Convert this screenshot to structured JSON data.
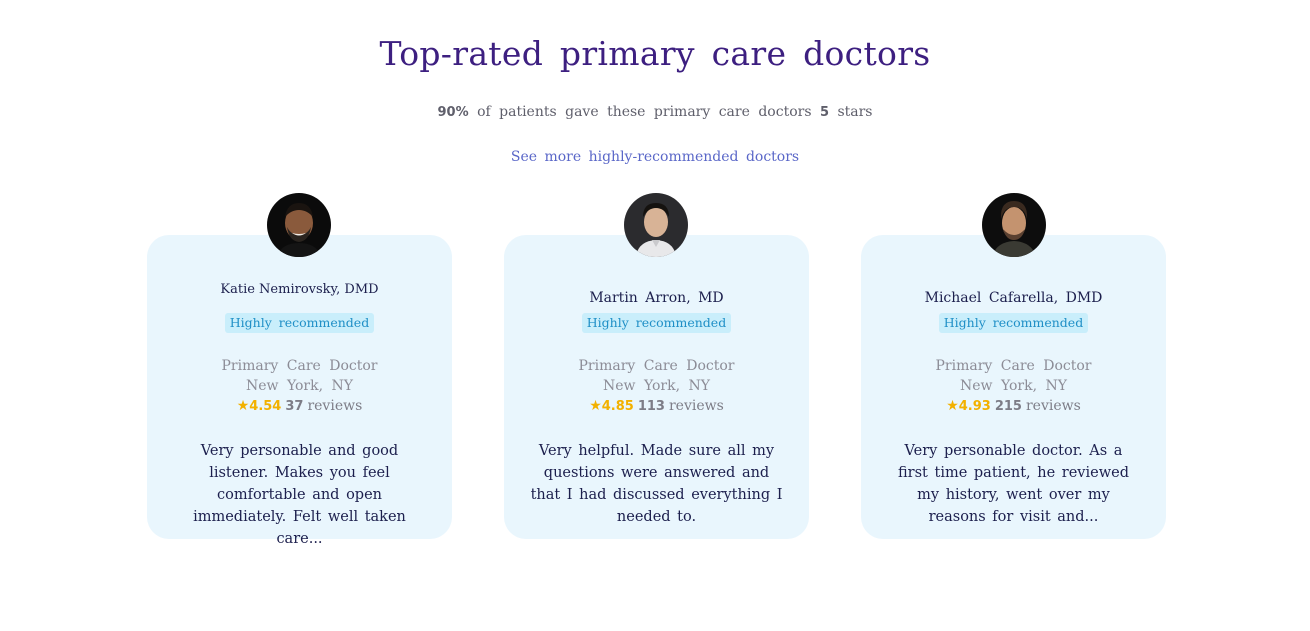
{
  "header": {
    "title": "Top-rated primary care doctors",
    "subtitle_percent": "90%",
    "subtitle_text_a": "of patients gave these primary care doctors",
    "subtitle_stars": "5",
    "subtitle_text_b": "stars",
    "see_more_label": "See more highly-recommended doctors"
  },
  "doctors": [
    {
      "name": "Katie Nemirovsky, DMD",
      "badge": "Highly recommended",
      "specialty": "Primary Care Doctor",
      "location": "New York, NY",
      "rating": "4.54",
      "review_count": "37",
      "reviews_label": "reviews",
      "review_excerpt": "Very personable and good listener. Makes you feel comfortable and open immediately. Felt well taken care..."
    },
    {
      "name": "Martin Arron, MD",
      "badge": "Highly recommended",
      "specialty": "Primary Care Doctor",
      "location": "New York, NY",
      "rating": "4.85",
      "review_count": "113",
      "reviews_label": "reviews",
      "review_excerpt": "Very helpful. Made sure all my questions were answered and that I had discussed everything I needed to."
    },
    {
      "name": "Michael Cafarella, DMD",
      "badge": "Highly recommended",
      "specialty": "Primary Care Doctor",
      "location": "New York, NY",
      "rating": "4.93",
      "review_count": "215",
      "reviews_label": "reviews",
      "review_excerpt": "Very personable doctor. As a first time patient, he reviewed my history, went over my reasons for visit and..."
    }
  ],
  "colors": {
    "title": "#3d1f80",
    "link": "#5a67c8",
    "card_bg": "#e9f6fd",
    "badge_bg": "#c9eefb",
    "badge_text": "#1f8fc6",
    "star": "#f2b100"
  },
  "icons": {
    "rating": "star-icon"
  }
}
